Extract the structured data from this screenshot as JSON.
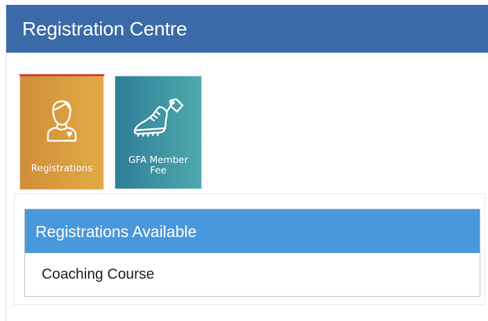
{
  "header": {
    "title": "Registration Centre"
  },
  "tiles": [
    {
      "label": "Registrations",
      "icon": "user-icon",
      "color": "#d99c40"
    },
    {
      "label": "GFA Member\nFee",
      "icon": "football-boot-tag-icon",
      "color": "#3d93a3"
    }
  ],
  "accent": {
    "active_tile_border": "#d83a35",
    "header_bg": "#3a6aa8",
    "panel_header_bg": "#4a98dc"
  },
  "panel": {
    "title": "Registrations Available",
    "items": [
      {
        "label": "Coaching Course"
      }
    ]
  }
}
